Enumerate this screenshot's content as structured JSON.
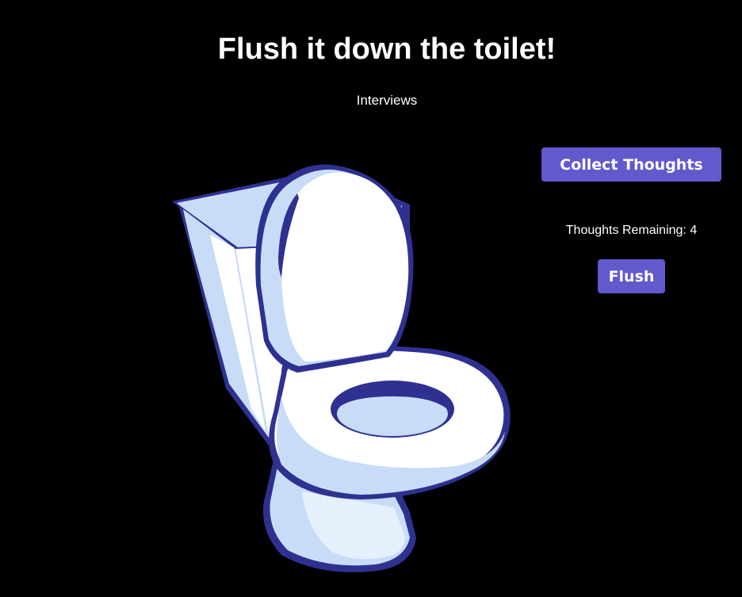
{
  "page": {
    "title": "Flush it down the toilet!",
    "subtitle": "Interviews"
  },
  "controls": {
    "collect_label": "Collect Thoughts",
    "remaining_label": "Thoughts Remaining: 4",
    "flush_label": "Flush"
  },
  "image": {
    "icon": "toilet-illustration"
  },
  "colors": {
    "background": "#000000",
    "button": "#6259cc",
    "toilet_outline": "#2e3190",
    "toilet_shade": "#c8dcf8",
    "toilet_white": "#ffffff"
  }
}
